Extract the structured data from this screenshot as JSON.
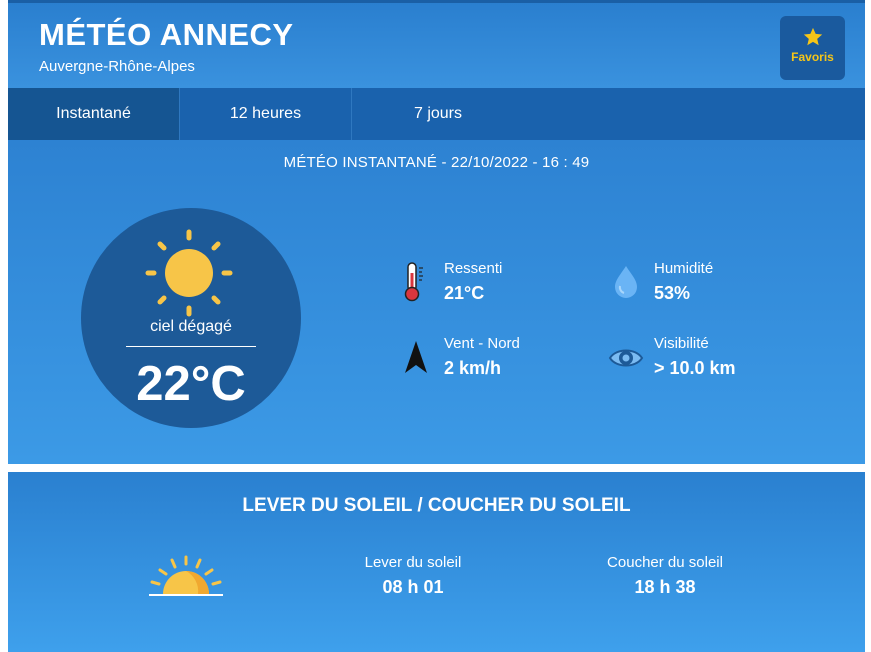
{
  "header": {
    "title": "MÉTÉO ANNECY",
    "region": "Auvergne-Rhône-Alpes",
    "favorites_label": "Favoris"
  },
  "tabs": [
    {
      "label": "Instantané",
      "active": true
    },
    {
      "label": "12 heures",
      "active": false
    },
    {
      "label": "7 jours",
      "active": false
    }
  ],
  "current": {
    "heading": "MÉTÉO INSTANTANÉ - 22/10/2022 - 16 : 49",
    "condition": "ciel dégagé",
    "temperature": "22°C",
    "feels_like": {
      "label": "Ressenti",
      "value": "21°C",
      "icon": "thermometer-icon"
    },
    "humidity": {
      "label": "Humidité",
      "value": "53%",
      "icon": "water-drop-icon"
    },
    "wind": {
      "label": "Vent - Nord",
      "value": "2 km/h",
      "icon": "wind-direction-arrow-icon"
    },
    "visibility": {
      "label": "Visibilité",
      "value": "> 10.0 km",
      "icon": "eye-icon"
    }
  },
  "sun": {
    "heading": "LEVER DU SOLEIL / COUCHER DU SOLEIL",
    "sunrise_label": "Lever du soleil",
    "sunrise_value": "08 h 01",
    "sunset_label": "Coucher du soleil",
    "sunset_value": "18 h 38"
  },
  "colors": {
    "sun_yellow": "#f7c548",
    "star_yellow": "#f5c518",
    "header_blue": "#2a7fcf",
    "tab_bar": "#1a62ad",
    "circle_dark": "#1d5a98"
  }
}
